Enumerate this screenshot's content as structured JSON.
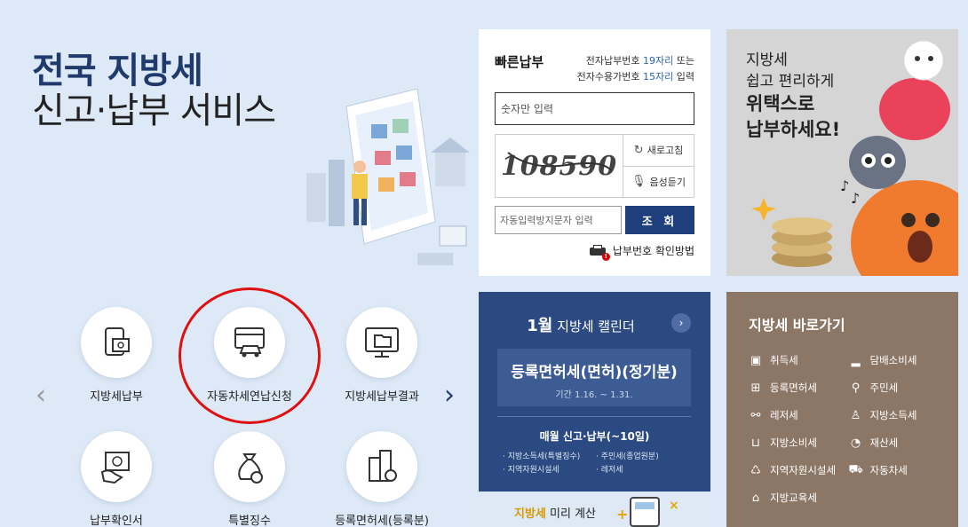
{
  "hero": {
    "line1": "전국 지방세",
    "line2": "신고·납부 서비스"
  },
  "quick_pay": {
    "title": "빠른납부",
    "info_line1_pre": "전자납부번호 ",
    "info_line1_hl": "19자리",
    "info_line1_post": " 또는",
    "info_line2_pre": "전자수용가번호 ",
    "info_line2_hl": "15자리",
    "info_line2_post": " 입력",
    "number_placeholder": "숫자만 입력",
    "captcha_text": "108590",
    "refresh_label": "새로고침",
    "audio_label": "음성듣기",
    "captcha_placeholder": "자동입력방지문자 입력",
    "lookup_label": "조 회",
    "confirm_label": "납부번호 확인방법"
  },
  "ad": {
    "line1": "지방세",
    "line2": "쉽고 편리하게",
    "line3": "위택스로",
    "line4": "납부하세요!"
  },
  "services": [
    {
      "label": "지방세납부",
      "icon": "tax-payment-icon"
    },
    {
      "label": "자동차세연납신청",
      "icon": "car-tax-icon"
    },
    {
      "label": "지방세납부결과",
      "icon": "payment-result-icon"
    },
    {
      "label": "납부확인서",
      "icon": "payment-certificate-icon"
    },
    {
      "label": "특별징수",
      "icon": "special-collection-icon"
    },
    {
      "label": "등록면허세(등록분)",
      "icon": "registration-tax-icon"
    }
  ],
  "calendar": {
    "month": "1월",
    "title": " 지방세 캘린더",
    "event_title": "등록면허세(면허)(정기분)",
    "event_period": "기간 1.16. ~ 1.31.",
    "monthly_title": "매월 신고·납부(~10일)",
    "monthly_items": [
      "지방소득세(특별징수)",
      "주민세(종업원분)",
      "지역자원시설세",
      "레저세"
    ],
    "bottom_highlight": "지방세",
    "bottom_text": " 미리 계산"
  },
  "shortcuts": {
    "title": "지방세 바로가기",
    "items": [
      {
        "label": "취득세",
        "icon": "acquisition-icon"
      },
      {
        "label": "담배소비세",
        "icon": "cigarette-icon"
      },
      {
        "label": "등록면허세",
        "icon": "registration-icon"
      },
      {
        "label": "주민세",
        "icon": "resident-icon"
      },
      {
        "label": "레저세",
        "icon": "bicycle-icon"
      },
      {
        "label": "지방소득세",
        "icon": "income-icon"
      },
      {
        "label": "지방소비세",
        "icon": "cart-icon"
      },
      {
        "label": "재산세",
        "icon": "property-icon"
      },
      {
        "label": "지역자원시설세",
        "icon": "recycle-icon"
      },
      {
        "label": "자동차세",
        "icon": "car-icon"
      },
      {
        "label": "지방교육세",
        "icon": "graduation-icon"
      }
    ]
  },
  "colors": {
    "background": "#dde9f6",
    "navy": "#1e3f7c",
    "calendar_bg": "#2c4a82",
    "shortcut_bg": "#8c7767",
    "highlight_ring": "#e01010"
  }
}
